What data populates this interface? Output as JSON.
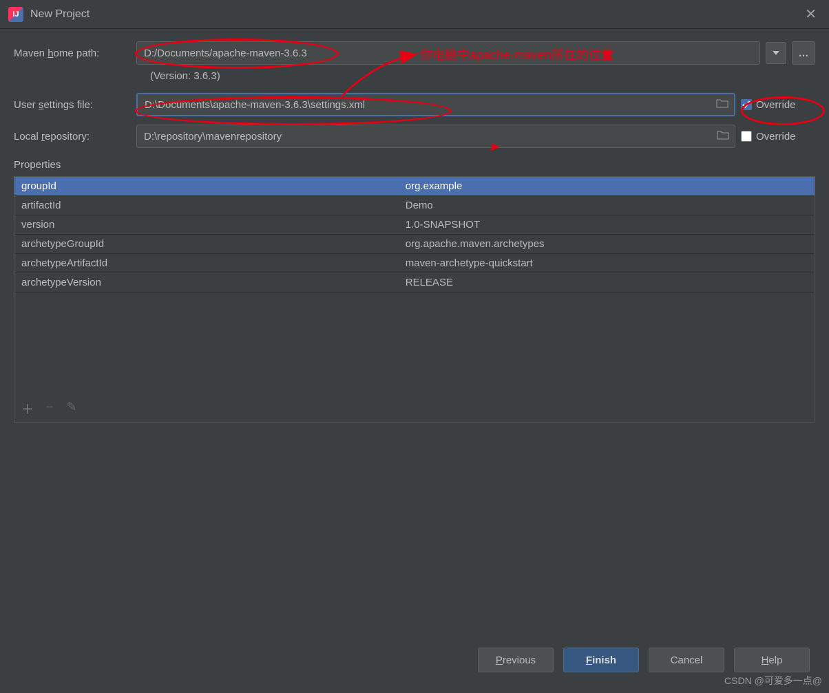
{
  "window": {
    "title": "New Project"
  },
  "labels": {
    "mavenHome_pre": "Maven ",
    "mavenHome_u": "h",
    "mavenHome_post": "ome path:",
    "userSettings_pre": "User ",
    "userSettings_u": "s",
    "userSettings_post": "ettings file:",
    "localRepo_pre": "Local ",
    "localRepo_u": "r",
    "localRepo_post": "epository:",
    "properties": "Properties",
    "override": "Override"
  },
  "fields": {
    "mavenHome": "D:/Documents/apache-maven-3.6.3",
    "version": "(Version: 3.6.3)",
    "userSettings": "D:\\Documents\\apache-maven-3.6.3\\settings.xml",
    "localRepo": "D:\\repository\\mavenrepository"
  },
  "overrides": {
    "userSettings": true,
    "localRepo": false
  },
  "properties": [
    {
      "key": "groupId",
      "value": "org.example"
    },
    {
      "key": "artifactId",
      "value": "Demo"
    },
    {
      "key": "version",
      "value": "1.0-SNAPSHOT"
    },
    {
      "key": "archetypeGroupId",
      "value": "org.apache.maven.archetypes"
    },
    {
      "key": "archetypeArtifactId",
      "value": "maven-archetype-quickstart"
    },
    {
      "key": "archetypeVersion",
      "value": "RELEASE"
    }
  ],
  "buttons": {
    "previous_u": "P",
    "previous_post": "revious",
    "finish_u": "F",
    "finish_post": "inish",
    "cancel": "Cancel",
    "help_u": "H",
    "help_post": "elp"
  },
  "annotations": {
    "note": "你电脑中apache-maven所在的位置"
  },
  "watermark": "CSDN @可爱多一点@"
}
